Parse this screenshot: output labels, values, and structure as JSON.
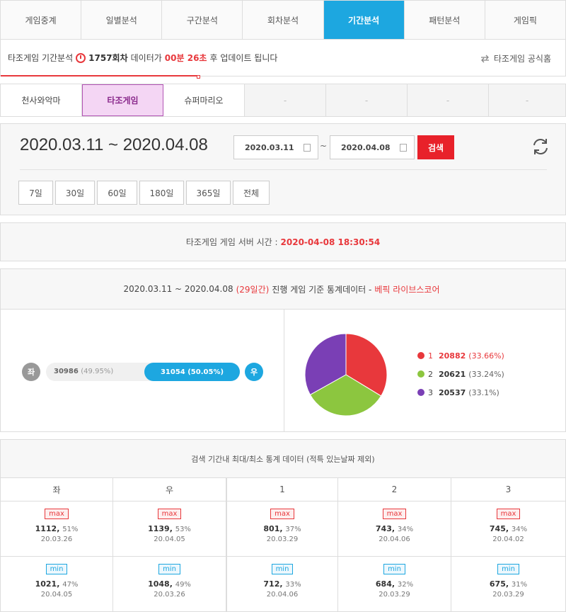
{
  "nav": {
    "tabs": [
      "게임중계",
      "일별분석",
      "구간분석",
      "회차분석",
      "기간분석",
      "패턴분석",
      "게임픽"
    ],
    "active_index": 4
  },
  "info": {
    "prefix": "타조게임 기간분석",
    "round": "1757회차",
    "mid": "데이터가",
    "countdown": "00분 26초",
    "suffix": "후 업데이트 됩니다",
    "official": "타조게임 공식홈",
    "progress_fraction": 0.35
  },
  "game_tabs": {
    "items": [
      "천사와악마",
      "타조게임",
      "슈퍼마리오",
      "-",
      "-",
      "-",
      "-"
    ],
    "active_index": 1
  },
  "date_panel": {
    "range_text": "2020.03.11 ~ 2020.04.08",
    "start": "2020.03.11",
    "tilde": "~",
    "end": "2020.04.08",
    "search_label": "검색",
    "ranges": [
      "7일",
      "30일",
      "60일",
      "180일",
      "365일",
      "전체"
    ]
  },
  "server": {
    "label": "타조게임 게임 서버 시간 :",
    "time": "2020-04-08 18:30:54"
  },
  "stats": {
    "head_range": "2020.03.11 ~ 2020.04.08",
    "head_days": "(29일간)",
    "head_mid": "진행 게임 기준 통계데이터 -",
    "head_source": "베픽 라이브스코어",
    "left_label": "좌",
    "right_label": "우",
    "left_value": "30986",
    "left_pct": "(49.95%)",
    "right_text": "31054 (50.05%)",
    "right_fraction": 0.5005,
    "legend": [
      {
        "num": "1",
        "value": "20882",
        "pct": "(33.66%)",
        "color": "#e8383c"
      },
      {
        "num": "2",
        "value": "20621",
        "pct": "(33.24%)",
        "color": "#8cc63f"
      },
      {
        "num": "3",
        "value": "20537",
        "pct": "(33.1%)",
        "color": "#7a3fb5"
      }
    ],
    "colors": {
      "left": "#999999",
      "right": "#1da7e0"
    }
  },
  "minmax": {
    "title": "검색 기간내 최대/최소 통계 데이터 (적특 있는날짜 제외)",
    "headers": [
      "좌",
      "우",
      "1",
      "2",
      "3"
    ],
    "max_label": "max",
    "min_label": "min",
    "max": [
      {
        "value": "1112",
        "pct": "51%",
        "date": "20.03.26"
      },
      {
        "value": "1139",
        "pct": "53%",
        "date": "20.04.05"
      },
      {
        "value": "801",
        "pct": "37%",
        "date": "20.03.29"
      },
      {
        "value": "743",
        "pct": "34%",
        "date": "20.04.06"
      },
      {
        "value": "745",
        "pct": "34%",
        "date": "20.04.02"
      }
    ],
    "min": [
      {
        "value": "1021",
        "pct": "47%",
        "date": "20.04.05"
      },
      {
        "value": "1048",
        "pct": "49%",
        "date": "20.03.26"
      },
      {
        "value": "712",
        "pct": "33%",
        "date": "20.04.06"
      },
      {
        "value": "684",
        "pct": "32%",
        "date": "20.03.29"
      },
      {
        "value": "675",
        "pct": "31%",
        "date": "20.03.29"
      }
    ]
  }
}
